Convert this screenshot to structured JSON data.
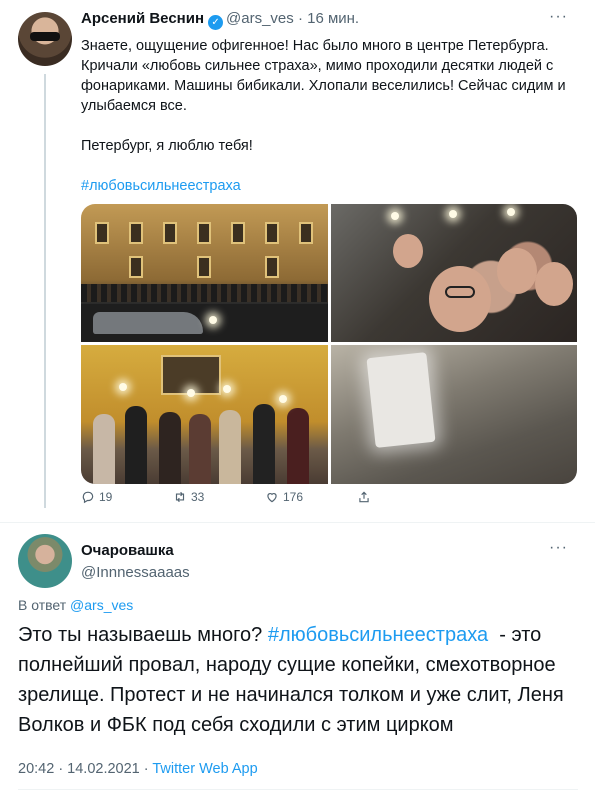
{
  "tweet1": {
    "author_name": "Арсений Веснин",
    "handle": "@ars_ves",
    "time": "· 16 мин.",
    "paragraphs": [
      "Знаете, ощущение офигенное! Нас было много в центре Петербурга. Кричали «любовь сильнее страха», мимо проходили десятки людей с фонариками. Машины бибикали. Хлопали веселились! Сейчас сидим и улыбаемся все.",
      "Петербург, я люблю тебя!"
    ],
    "hashtag": "#любовьсильнеестраха",
    "more": "···",
    "stats": {
      "replies": "19",
      "retweets": "33",
      "likes": "176"
    }
  },
  "tweet2": {
    "author_name": "Очаровашка",
    "handle": "@Innnessaaaas",
    "more": "···",
    "reply_prefix": "В ответ",
    "reply_handle": "@ars_ves",
    "text_before": "Это ты называешь много? ",
    "hashtag": "#любовьсильнеестраха",
    "text_after": "  - это полнейший провал, народу сущие копейки, смехотворное зрелище. Протест и не начинался толком и уже слит, Леня Волков и ФБК под себя сходили с этим цирком",
    "timestamp": "20:42 · 14.02.2021 · ",
    "source": "Twitter Web App"
  },
  "icons": [
    "reply-icon",
    "retweet-icon",
    "like-icon",
    "share-icon",
    "verified-icon",
    "more-icon"
  ],
  "colors": {
    "link": "#1d9bf0",
    "secondary_text": "#536471",
    "text": "#0f1419"
  }
}
